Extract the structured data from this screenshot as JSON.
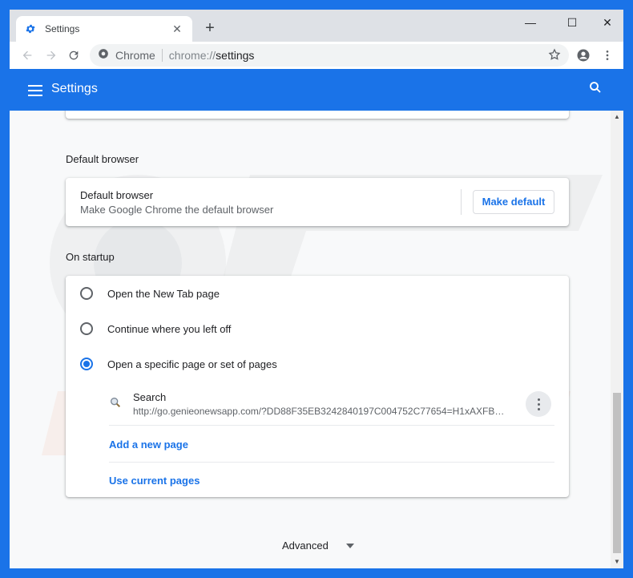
{
  "browser": {
    "tab_title": "Settings",
    "new_tab_symbol": "+",
    "window_controls": {
      "minimize": "—",
      "maximize": "☐",
      "close": "✕"
    },
    "omnibox": {
      "site_label": "Chrome",
      "url_scheme": "chrome://",
      "url_host": "settings"
    }
  },
  "header": {
    "title": "Settings"
  },
  "default_browser": {
    "section_title": "Default browser",
    "card_title": "Default browser",
    "card_subtitle": "Make Google Chrome the default browser",
    "button_label": "Make default"
  },
  "on_startup": {
    "section_title": "On startup",
    "options": [
      {
        "label": "Open the New Tab page",
        "checked": false
      },
      {
        "label": "Continue where you left off",
        "checked": false
      },
      {
        "label": "Open a specific page or set of pages",
        "checked": true
      }
    ],
    "pages": [
      {
        "title": "Search",
        "url": "http://go.genieonewsapp.com/?DD88F35EB3242840197C004752C77654=H1xAXFB…"
      }
    ],
    "add_page_label": "Add a new page",
    "use_current_label": "Use current pages"
  },
  "advanced": {
    "label": "Advanced"
  },
  "colors": {
    "accent": "#1a73e8",
    "frame": "#dee1e6",
    "content_bg": "#f8f9fa"
  },
  "icons": [
    "gear-icon",
    "close-icon",
    "plus-icon",
    "back-arrow-icon",
    "forward-arrow-icon",
    "reload-icon",
    "info-icon",
    "star-icon",
    "profile-icon",
    "kebab-menu-icon",
    "hamburger-icon",
    "search-icon",
    "magnifier-icon",
    "chevron-down-icon"
  ]
}
